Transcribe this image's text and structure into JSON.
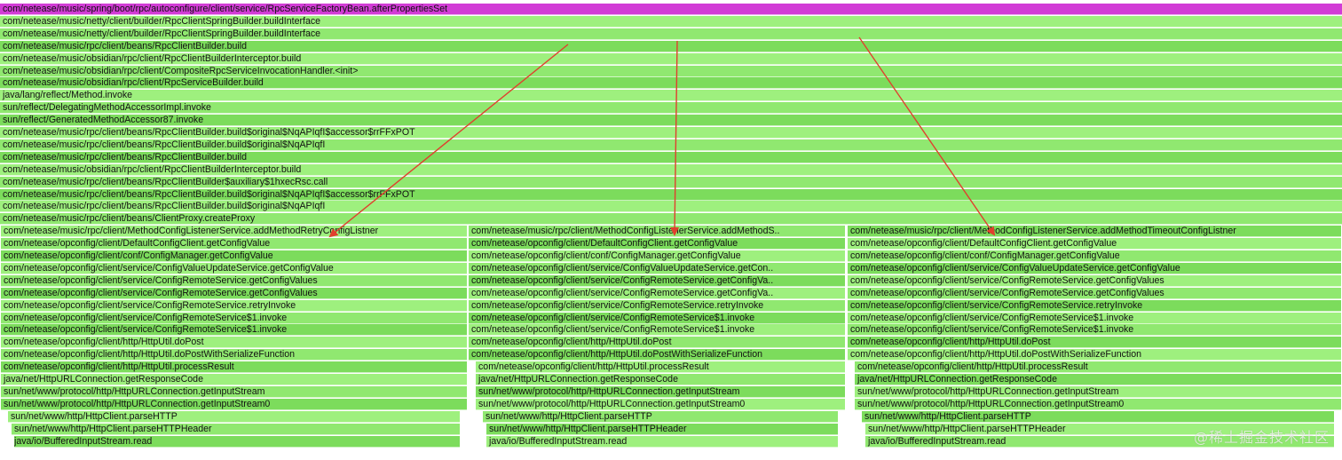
{
  "colors": {
    "top_frame": "#d23cd6",
    "green_light": "#9ef07e",
    "green_mid": "#90e870",
    "green_dark": "#7cdc5c",
    "arrow": "#e0402e",
    "yellow_frame": "#d8d050"
  },
  "top_frame": {
    "label": "com/netease/music/spring/boot/rpc/autoconfigure/client/service/RpcServiceFactoryBean.afterPropertiesSet"
  },
  "shared_stack": [
    "com/netease/music/netty/client/builder/RpcClientSpringBuilder.buildInterface",
    "com/netease/music/netty/client/builder/RpcClientSpringBuilder.buildInterface",
    "com/netease/music/rpc/client/beans/RpcClientBuilder.build",
    "com/netease/music/obsidian/rpc/client/RpcClientBuilderInterceptor.build",
    "com/netease/music/obsidian/rpc/client/CompositeRpcServiceInvocationHandler.<init>",
    "com/netease/music/obsidian/rpc/client/RpcServiceBuilder.build",
    "java/lang/reflect/Method.invoke",
    "sun/reflect/DelegatingMethodAccessorImpl.invoke",
    "sun/reflect/GeneratedMethodAccessor87.invoke",
    "com/netease/music/rpc/client/beans/RpcClientBuilder.build$original$NqAPIqfI$accessor$rrFFxPOT",
    "com/netease/music/rpc/client/beans/RpcClientBuilder.build$original$NqAPIqfI",
    "com/netease/music/rpc/client/beans/RpcClientBuilder.build",
    "com/netease/music/obsidian/rpc/client/RpcClientBuilderInterceptor.build",
    "com/netease/music/rpc/client/beans/RpcClientBuilder$auxiliary$1hxecRsc.call",
    "com/netease/music/rpc/client/beans/RpcClientBuilder.build$original$NqAPIqfI$accessor$rrFFxPOT",
    "com/netease/music/rpc/client/beans/RpcClientBuilder.build$original$NqAPIqfI",
    "com/netease/music/rpc/client/beans/ClientProxy.createProxy"
  ],
  "columns": [
    {
      "frames": [
        "com/netease/music/rpc/client/MethodConfigListenerService.addMethodRetryConfigListner",
        "com/netease/opconfig/client/DefaultConfigClient.getConfigValue",
        "com/netease/opconfig/client/conf/ConfigManager.getConfigValue",
        "com/netease/opconfig/client/service/ConfigValueUpdateService.getConfigValue",
        "com/netease/opconfig/client/service/ConfigRemoteService.getConfigValues",
        "com/netease/opconfig/client/service/ConfigRemoteService.getConfigValues",
        "com/netease/opconfig/client/service/ConfigRemoteService.retryInvoke",
        "com/netease/opconfig/client/service/ConfigRemoteService$1.invoke",
        "com/netease/opconfig/client/service/ConfigRemoteService$1.invoke",
        "com/netease/opconfig/client/http/HttpUtil.doPost",
        "com/netease/opconfig/client/http/HttpUtil.doPostWithSerializeFunction",
        "com/netease/opconfig/client/http/HttpUtil.processResult",
        "java/net/HttpURLConnection.getResponseCode",
        "sun/net/www/protocol/http/HttpURLConnection.getInputStream",
        "sun/net/www/protocol/http/HttpURLConnection.getInputStream0",
        "sun/net/www/http/HttpClient.parseHTTP",
        "sun/net/www/http/HttpClient.parseHTTPHeader",
        "java/io/BufferedInputStream.read"
      ]
    },
    {
      "frames": [
        "com/netease/music/rpc/client/MethodConfigListenerService.addMethodS..",
        "com/netease/opconfig/client/DefaultConfigClient.getConfigValue",
        "com/netease/opconfig/client/conf/ConfigManager.getConfigValue",
        "com/netease/opconfig/client/service/ConfigValueUpdateService.getCon..",
        "com/netease/opconfig/client/service/ConfigRemoteService.getConfigVa..",
        "com/netease/opconfig/client/service/ConfigRemoteService.getConfigVa..",
        "com/netease/opconfig/client/service/ConfigRemoteService.retryInvoke",
        "com/netease/opconfig/client/service/ConfigRemoteService$1.invoke",
        "com/netease/opconfig/client/service/ConfigRemoteService$1.invoke",
        "com/netease/opconfig/client/http/HttpUtil.doPost",
        "com/netease/opconfig/client/http/HttpUtil.doPostWithSerializeFunction",
        "com/netease/opconfig/client/http/HttpUtil.processResult",
        "java/net/HttpURLConnection.getResponseCode",
        "sun/net/www/protocol/http/HttpURLConnection.getInputStream",
        "sun/net/www/protocol/http/HttpURLConnection.getInputStream0",
        "sun/net/www/http/HttpClient.parseHTTP",
        "sun/net/www/http/HttpClient.parseHTTPHeader",
        "java/io/BufferedInputStream.read"
      ]
    },
    {
      "frames": [
        "com/netease/music/rpc/client/MethodConfigListenerService.addMethodTimeoutConfigListner",
        "com/netease/opconfig/client/DefaultConfigClient.getConfigValue",
        "com/netease/opconfig/client/conf/ConfigManager.getConfigValue",
        "com/netease/opconfig/client/service/ConfigValueUpdateService.getConfigValue",
        "com/netease/opconfig/client/service/ConfigRemoteService.getConfigValues",
        "com/netease/opconfig/client/service/ConfigRemoteService.getConfigValues",
        "com/netease/opconfig/client/service/ConfigRemoteService.retryInvoke",
        "com/netease/opconfig/client/service/ConfigRemoteService$1.invoke",
        "com/netease/opconfig/client/service/ConfigRemoteService$1.invoke",
        "com/netease/opconfig/client/http/HttpUtil.doPost",
        "com/netease/opconfig/client/http/HttpUtil.doPostWithSerializeFunction",
        "com/netease/opconfig/client/http/HttpUtil.processResult",
        "java/net/HttpURLConnection.getResponseCode",
        "sun/net/www/protocol/http/HttpURLConnection.getInputStream",
        "sun/net/www/protocol/http/HttpURLConnection.getInputStream0",
        "sun/net/www/http/HttpClient.parseHTTP",
        "sun/net/www/http/HttpClient.parseHTTPHeader",
        "java/io/BufferedInputStream.read"
      ]
    }
  ],
  "watermark": "@稀土掘金技术社区"
}
